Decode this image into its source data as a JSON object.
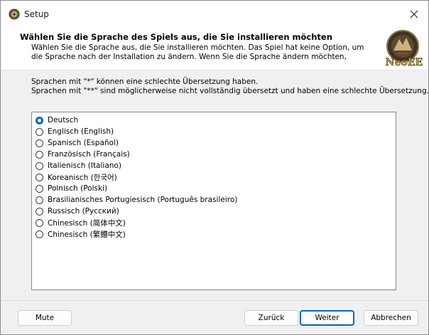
{
  "window": {
    "title": "Setup"
  },
  "header": {
    "heading": "Wählen Sie die Sprache des Spiels aus, die Sie installieren möchten",
    "description": "Wählen Sie die Sprache aus, die Sie installieren möchten. Das Spiel hat keine Option, um die Sprache nach der Installation zu ändern. Wenn Sie die Sprache ändern möchten, müssen Sie das Spiel neu installieren.",
    "logo_text": "NeoEE"
  },
  "notes": {
    "line1": "Sprachen mit \"*\" können eine schlechte Übersetzung haben.",
    "line2": "Sprachen mit \"**\" sind möglicherweise nicht vollständig übersetzt und haben eine schlechte Übersetzung."
  },
  "languages": [
    {
      "label": "Deutsch",
      "selected": true
    },
    {
      "label": "Englisch (English)",
      "selected": false
    },
    {
      "label": "Spanisch (Español)",
      "selected": false
    },
    {
      "label": "Französisch (Français)",
      "selected": false
    },
    {
      "label": "Italienisch (Italiano)",
      "selected": false
    },
    {
      "label": "Koreanisch (한국어)",
      "selected": false
    },
    {
      "label": "Polnisch (Polski)",
      "selected": false
    },
    {
      "label": "Brasilianisches Portugiesisch (Português brasileiro)",
      "selected": false
    },
    {
      "label": "Russisch (Русский)",
      "selected": false
    },
    {
      "label": "Chinesisch (简体中文)",
      "selected": false
    },
    {
      "label": "Chinesisch (繁體中文)",
      "selected": false
    }
  ],
  "buttons": {
    "mute": "Mute",
    "back": "Zurück",
    "next": "Weiter",
    "cancel": "Abbrechen"
  },
  "colors": {
    "accent": "#0067c0",
    "window_bg": "#f0f0f0",
    "panel_bg": "#ffffff"
  },
  "icons": {
    "app": "setup-app-icon",
    "close": "close-icon"
  }
}
